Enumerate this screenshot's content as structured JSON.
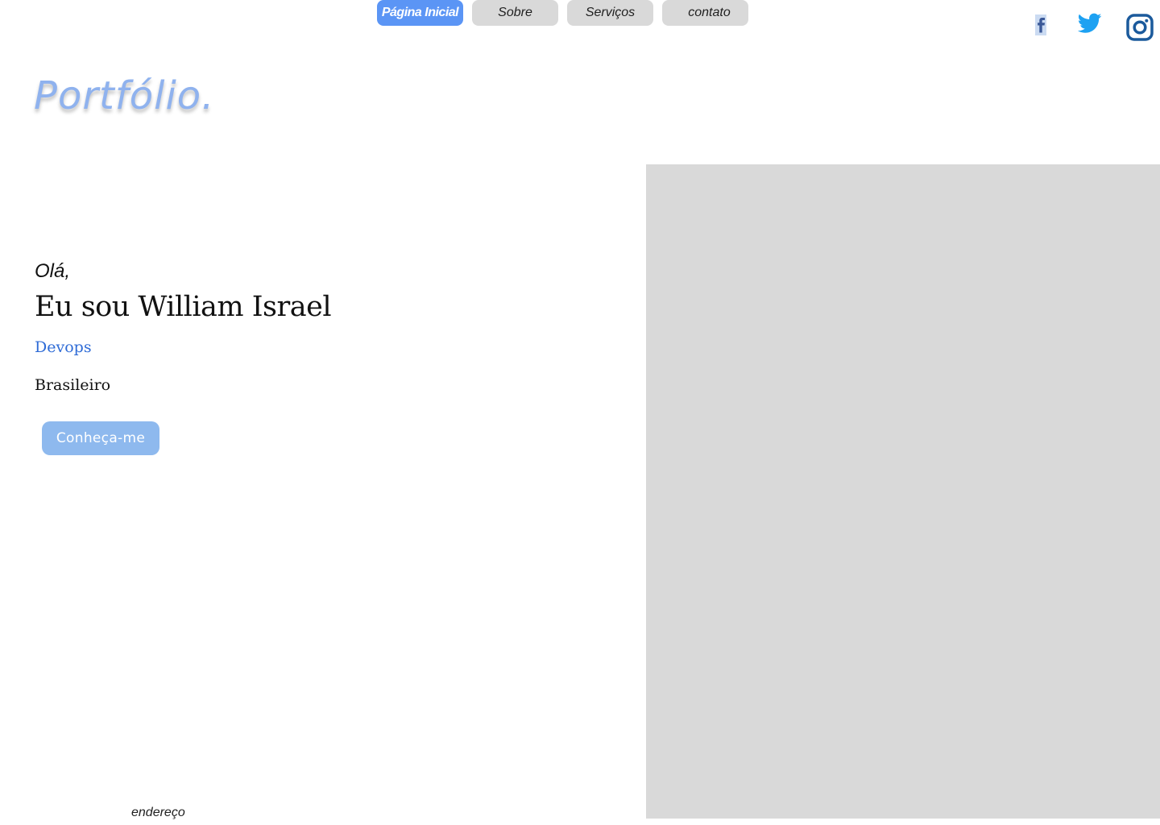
{
  "nav": {
    "items": [
      {
        "label": "Página Inicial",
        "active": true
      },
      {
        "label": "Sobre",
        "active": false
      },
      {
        "label": "Serviços",
        "active": false
      },
      {
        "label": "contato",
        "active": false
      }
    ]
  },
  "social": {
    "icons": [
      "facebook-icon",
      "twitter-icon",
      "instagram-icon"
    ]
  },
  "logo": {
    "text": "Portfólio."
  },
  "hero": {
    "greeting": "Olá,",
    "headline": "Eu sou William Israel",
    "role": "Devops",
    "nationality": "Brasileiro",
    "cta_label": "Conheça-me"
  },
  "footer": {
    "address_label": "endereço"
  },
  "colors": {
    "accent": "#5b95f5",
    "logo": "#8fb2ee",
    "role_text": "#2e6bd6",
    "cta_bg": "#8eb9ee",
    "nav_bg": "#d9d9d9",
    "image_placeholder": "#d9d9d9",
    "twitter": "#1da1f2",
    "instagram": "#1b5a9c",
    "facebook": "#3b5998"
  }
}
